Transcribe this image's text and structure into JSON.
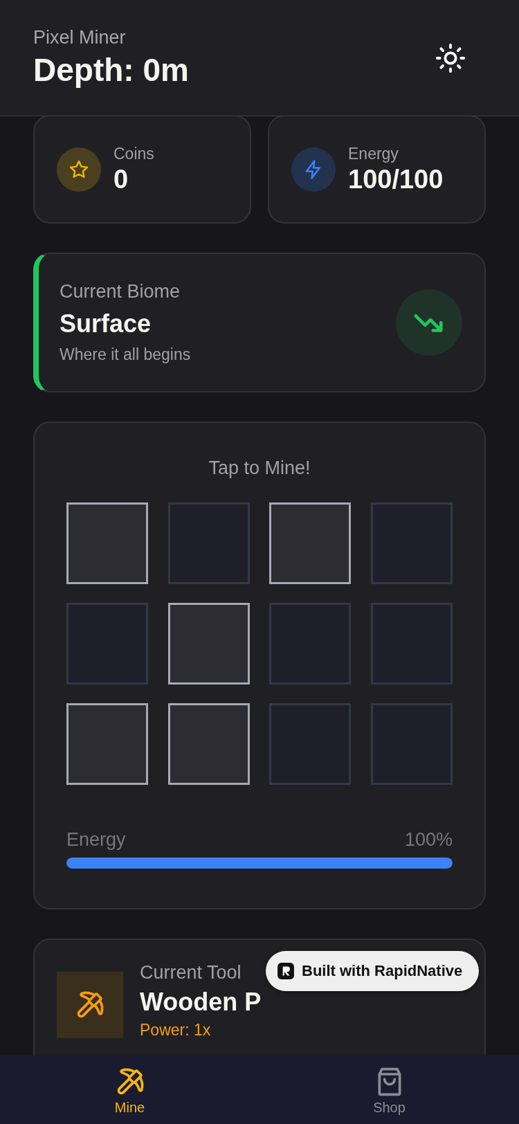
{
  "header": {
    "app_name": "Pixel Miner",
    "title": "Depth: 0m"
  },
  "stats": [
    {
      "kind": "coins",
      "label": "Coins",
      "value": "0"
    },
    {
      "kind": "energy",
      "label": "Energy",
      "value": "100/100"
    }
  ],
  "biome": {
    "label": "Current Biome",
    "name": "Surface",
    "description": "Where it all begins",
    "color": "#22c55e"
  },
  "mine": {
    "title": "Tap to Mine!",
    "tiles": [
      {
        "highlighted": true
      },
      {
        "highlighted": false
      },
      {
        "highlighted": true
      },
      {
        "highlighted": false
      },
      {
        "highlighted": false
      },
      {
        "highlighted": true
      },
      {
        "highlighted": false
      },
      {
        "highlighted": false
      },
      {
        "highlighted": true
      },
      {
        "highlighted": true
      },
      {
        "highlighted": false
      },
      {
        "highlighted": false
      }
    ],
    "energy": {
      "label": "Energy",
      "reading": "100%",
      "level": 1
    }
  },
  "tool": {
    "label": "Current Tool",
    "name": "Wooden P",
    "power": "Power: 1x"
  },
  "badge": {
    "text": "Built with RapidNative"
  },
  "tabs": [
    {
      "kind": "mine",
      "label": "Mine",
      "selected": true
    },
    {
      "kind": "shop",
      "label": "Shop",
      "selected": false
    }
  ]
}
